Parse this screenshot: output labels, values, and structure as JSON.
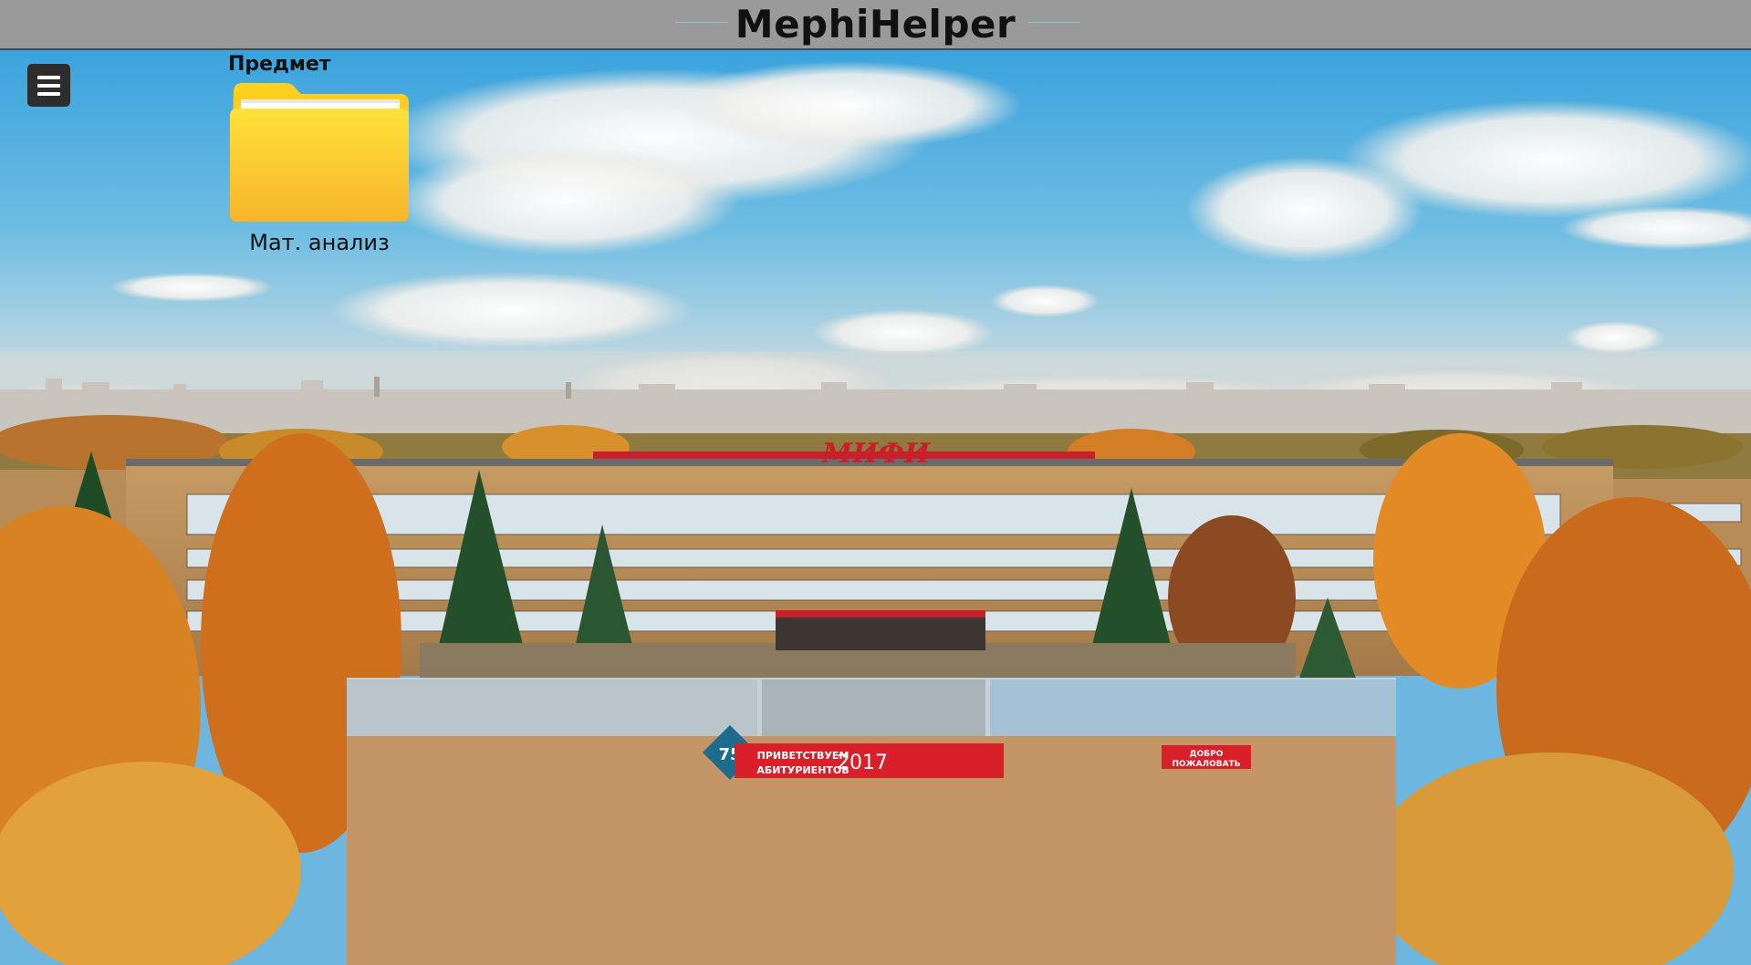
{
  "header": {
    "title": "MephiHelper"
  },
  "menu": {
    "icon": "hamburger-menu-icon"
  },
  "subjects": {
    "heading": "Предмет",
    "folders": [
      {
        "label": "Мат. анализ",
        "icon": "folder-icon"
      }
    ]
  },
  "background": {
    "description_icon": "campus-photo",
    "banners": {
      "anniversary": "75",
      "welcome": "ПРИВЕТСТВУЕМ АБИТУРИЕНТОВ",
      "year": "2017",
      "greeting": "ДОБРО ПОЖАЛОВАТЬ",
      "roof_logo": "МИФИ"
    }
  },
  "colors": {
    "topbar": "#9a9a9a",
    "folder_yellow": "#ffd21f",
    "menu_button": "#2d2d2d"
  }
}
